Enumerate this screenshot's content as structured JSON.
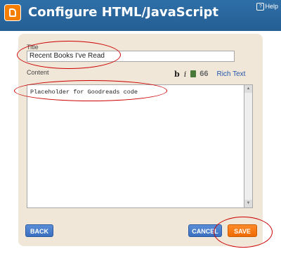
{
  "header": {
    "title": "Configure HTML/JavaScript",
    "help_label": "Help",
    "help_icon_glyph": "?",
    "color": "#2a6aa1"
  },
  "form": {
    "title_label": "Title",
    "title_value": "Recent Books I've Read",
    "content_label": "Content",
    "content_value": "Placeholder for Goodreads code",
    "toolbar": {
      "bold_label": "b",
      "italic_label": "i",
      "quote_label": "66",
      "rich_text_label": "Rich Text"
    }
  },
  "buttons": {
    "back_label": "BACK",
    "cancel_label": "CANCEL",
    "save_label": "SAVE"
  },
  "colors": {
    "accent": "#2a6aa1",
    "save_button": "#f57d00",
    "annotation": "#cc0000",
    "panel": "#f0e7d8"
  }
}
